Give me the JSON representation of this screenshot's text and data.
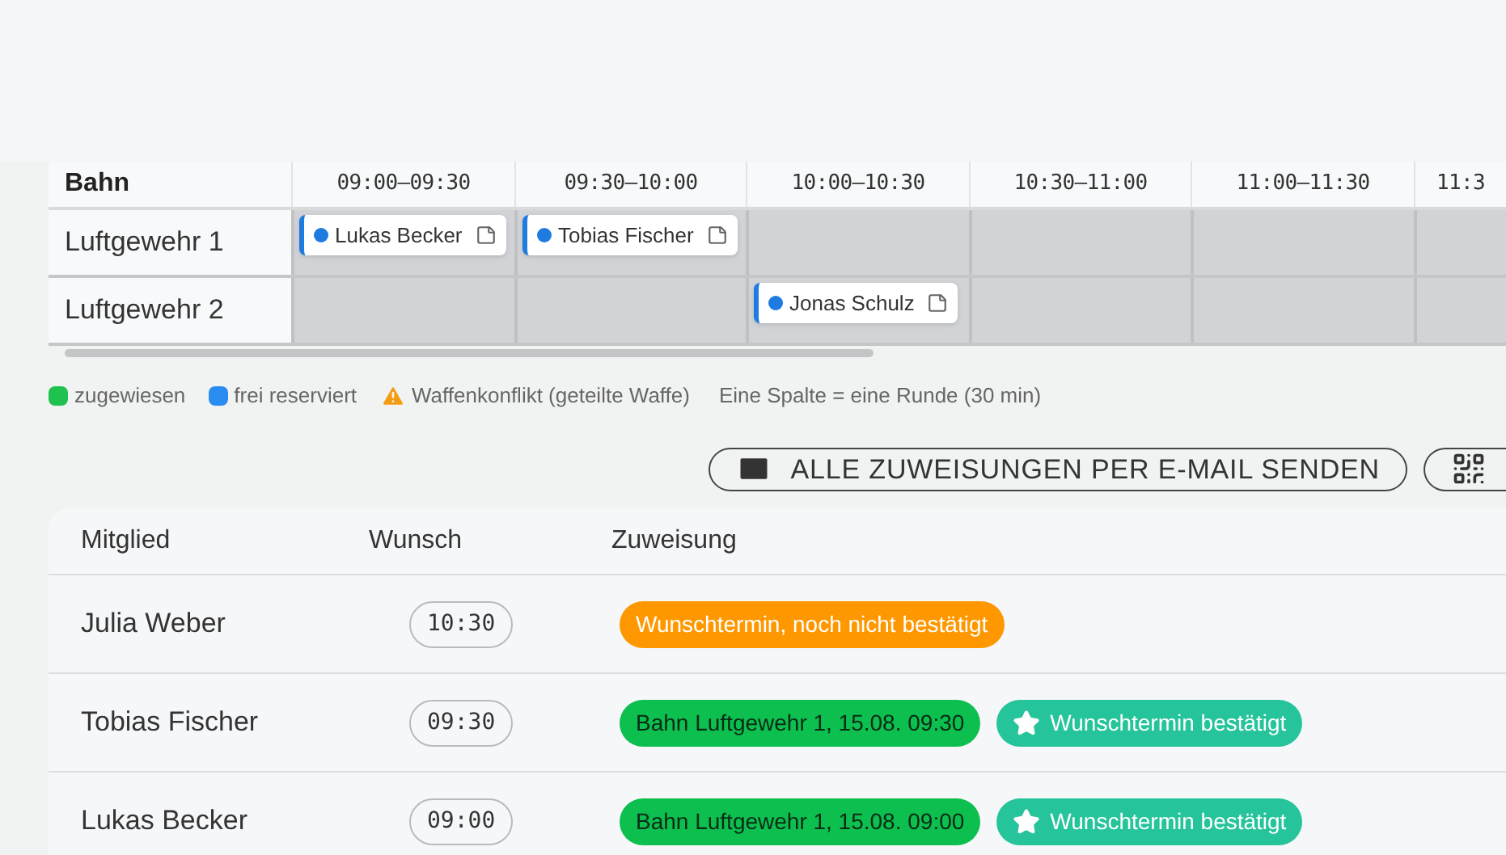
{
  "schedule": {
    "lane_header": "Bahn",
    "slots": [
      "09:00–09:30",
      "09:30–10:00",
      "10:00–10:30",
      "10:30–11:00",
      "11:00–11:30",
      "11:3"
    ],
    "lanes": [
      {
        "name": "Luftgewehr 1",
        "cells": [
          {
            "name": "Lukas Becker",
            "color": "#1e7be0"
          },
          {
            "name": "Tobias Fischer",
            "color": "#1e7be0"
          },
          {},
          {},
          {},
          {}
        ]
      },
      {
        "name": "Luftgewehr 2",
        "cells": [
          {},
          {},
          {
            "name": "Jonas Schulz",
            "color": "#1e7be0"
          },
          {},
          {},
          {}
        ]
      }
    ]
  },
  "legend": [
    {
      "kind": "swatch",
      "color": "#1fc24f",
      "label": "zugewiesen"
    },
    {
      "kind": "swatch",
      "color": "#2a8cf0",
      "label": "frei reserviert"
    },
    {
      "kind": "warning",
      "label": "Waffenkonflikt (geteilte Waffe)"
    },
    {
      "kind": "note",
      "label": "Eine Spalte = eine Runde (30 min)"
    }
  ],
  "actions": [
    {
      "kind": "email",
      "label": "ALLE ZUWEISUNGEN PER E-MAIL SENDEN"
    },
    {
      "kind": "qr"
    }
  ],
  "members": {
    "columns": [
      "Mitglied",
      "Wunsch",
      "Zuweisung"
    ],
    "rows": [
      {
        "name": "Julia Weber",
        "wish": "10:30",
        "tags": [
          {
            "kind": "pending",
            "text": "Wunschtermin, noch nicht bestätigt"
          }
        ]
      },
      {
        "name": "Tobias Fischer",
        "wish": "09:30",
        "tags": [
          {
            "kind": "lane",
            "text": "Bahn Luftgewehr 1, 15.08. 09:30"
          },
          {
            "kind": "confirmed",
            "text": "Wunschtermin bestätigt"
          }
        ]
      },
      {
        "name": "Lukas Becker",
        "wish": "09:00",
        "tags": [
          {
            "kind": "lane",
            "text": "Bahn Luftgewehr 1, 15.08. 09:00"
          },
          {
            "kind": "confirmed",
            "text": "Wunschtermin bestätigt"
          }
        ]
      }
    ]
  }
}
